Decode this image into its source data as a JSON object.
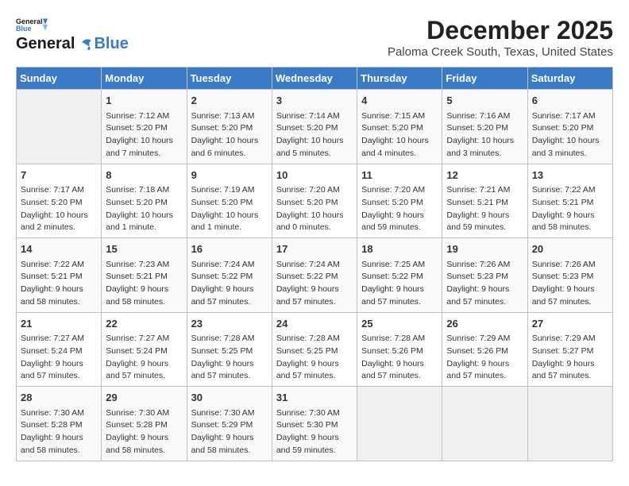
{
  "header": {
    "logo_general": "General",
    "logo_blue": "Blue",
    "month_year": "December 2025",
    "location": "Paloma Creek South, Texas, United States"
  },
  "days_of_week": [
    "Sunday",
    "Monday",
    "Tuesday",
    "Wednesday",
    "Thursday",
    "Friday",
    "Saturday"
  ],
  "weeks": [
    [
      {
        "day": "",
        "content": ""
      },
      {
        "day": "1",
        "content": "Sunrise: 7:12 AM\nSunset: 5:20 PM\nDaylight: 10 hours\nand 7 minutes."
      },
      {
        "day": "2",
        "content": "Sunrise: 7:13 AM\nSunset: 5:20 PM\nDaylight: 10 hours\nand 6 minutes."
      },
      {
        "day": "3",
        "content": "Sunrise: 7:14 AM\nSunset: 5:20 PM\nDaylight: 10 hours\nand 5 minutes."
      },
      {
        "day": "4",
        "content": "Sunrise: 7:15 AM\nSunset: 5:20 PM\nDaylight: 10 hours\nand 4 minutes."
      },
      {
        "day": "5",
        "content": "Sunrise: 7:16 AM\nSunset: 5:20 PM\nDaylight: 10 hours\nand 3 minutes."
      },
      {
        "day": "6",
        "content": "Sunrise: 7:17 AM\nSunset: 5:20 PM\nDaylight: 10 hours\nand 3 minutes."
      }
    ],
    [
      {
        "day": "7",
        "content": "Sunrise: 7:17 AM\nSunset: 5:20 PM\nDaylight: 10 hours\nand 2 minutes."
      },
      {
        "day": "8",
        "content": "Sunrise: 7:18 AM\nSunset: 5:20 PM\nDaylight: 10 hours\nand 1 minute."
      },
      {
        "day": "9",
        "content": "Sunrise: 7:19 AM\nSunset: 5:20 PM\nDaylight: 10 hours\nand 1 minute."
      },
      {
        "day": "10",
        "content": "Sunrise: 7:20 AM\nSunset: 5:20 PM\nDaylight: 10 hours\nand 0 minutes."
      },
      {
        "day": "11",
        "content": "Sunrise: 7:20 AM\nSunset: 5:20 PM\nDaylight: 9 hours\nand 59 minutes."
      },
      {
        "day": "12",
        "content": "Sunrise: 7:21 AM\nSunset: 5:21 PM\nDaylight: 9 hours\nand 59 minutes."
      },
      {
        "day": "13",
        "content": "Sunrise: 7:22 AM\nSunset: 5:21 PM\nDaylight: 9 hours\nand 58 minutes."
      }
    ],
    [
      {
        "day": "14",
        "content": "Sunrise: 7:22 AM\nSunset: 5:21 PM\nDaylight: 9 hours\nand 58 minutes."
      },
      {
        "day": "15",
        "content": "Sunrise: 7:23 AM\nSunset: 5:21 PM\nDaylight: 9 hours\nand 58 minutes."
      },
      {
        "day": "16",
        "content": "Sunrise: 7:24 AM\nSunset: 5:22 PM\nDaylight: 9 hours\nand 57 minutes."
      },
      {
        "day": "17",
        "content": "Sunrise: 7:24 AM\nSunset: 5:22 PM\nDaylight: 9 hours\nand 57 minutes."
      },
      {
        "day": "18",
        "content": "Sunrise: 7:25 AM\nSunset: 5:22 PM\nDaylight: 9 hours\nand 57 minutes."
      },
      {
        "day": "19",
        "content": "Sunrise: 7:26 AM\nSunset: 5:23 PM\nDaylight: 9 hours\nand 57 minutes."
      },
      {
        "day": "20",
        "content": "Sunrise: 7:26 AM\nSunset: 5:23 PM\nDaylight: 9 hours\nand 57 minutes."
      }
    ],
    [
      {
        "day": "21",
        "content": "Sunrise: 7:27 AM\nSunset: 5:24 PM\nDaylight: 9 hours\nand 57 minutes."
      },
      {
        "day": "22",
        "content": "Sunrise: 7:27 AM\nSunset: 5:24 PM\nDaylight: 9 hours\nand 57 minutes."
      },
      {
        "day": "23",
        "content": "Sunrise: 7:28 AM\nSunset: 5:25 PM\nDaylight: 9 hours\nand 57 minutes."
      },
      {
        "day": "24",
        "content": "Sunrise: 7:28 AM\nSunset: 5:25 PM\nDaylight: 9 hours\nand 57 minutes."
      },
      {
        "day": "25",
        "content": "Sunrise: 7:28 AM\nSunset: 5:26 PM\nDaylight: 9 hours\nand 57 minutes."
      },
      {
        "day": "26",
        "content": "Sunrise: 7:29 AM\nSunset: 5:26 PM\nDaylight: 9 hours\nand 57 minutes."
      },
      {
        "day": "27",
        "content": "Sunrise: 7:29 AM\nSunset: 5:27 PM\nDaylight: 9 hours\nand 57 minutes."
      }
    ],
    [
      {
        "day": "28",
        "content": "Sunrise: 7:30 AM\nSunset: 5:28 PM\nDaylight: 9 hours\nand 58 minutes."
      },
      {
        "day": "29",
        "content": "Sunrise: 7:30 AM\nSunset: 5:28 PM\nDaylight: 9 hours\nand 58 minutes."
      },
      {
        "day": "30",
        "content": "Sunrise: 7:30 AM\nSunset: 5:29 PM\nDaylight: 9 hours\nand 58 minutes."
      },
      {
        "day": "31",
        "content": "Sunrise: 7:30 AM\nSunset: 5:30 PM\nDaylight: 9 hours\nand 59 minutes."
      },
      {
        "day": "",
        "content": ""
      },
      {
        "day": "",
        "content": ""
      },
      {
        "day": "",
        "content": ""
      }
    ]
  ]
}
